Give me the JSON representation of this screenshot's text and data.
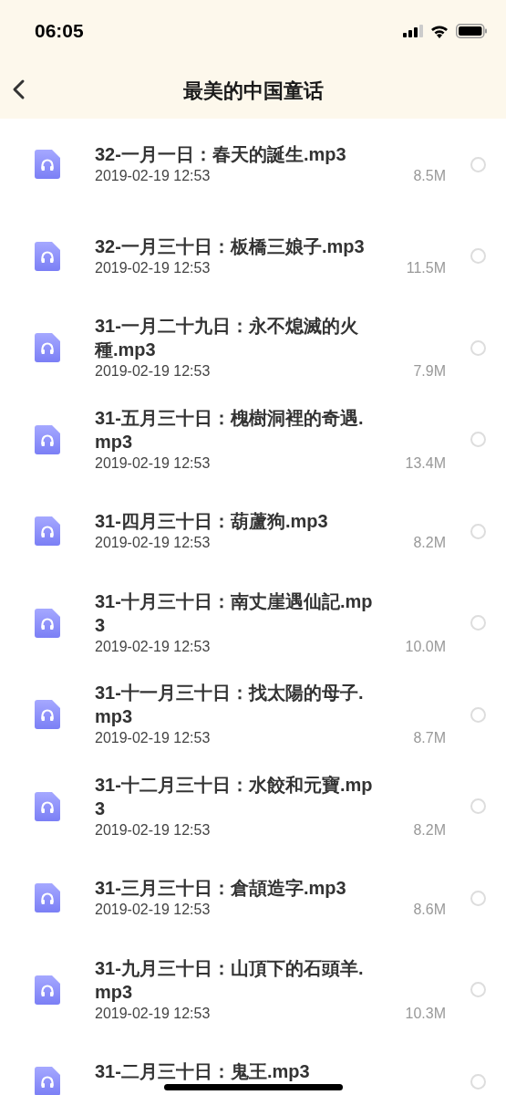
{
  "status_bar": {
    "time": "06:05"
  },
  "header": {
    "title": "最美的中国童话"
  },
  "files": [
    {
      "name": "32-一月一日：春天的誕生.mp3",
      "date": "2019-02-19 12:53",
      "size": "8.5M",
      "selected": false
    },
    {
      "name": "32-一月三十日：板橋三娘子.mp3",
      "date": "2019-02-19 12:53",
      "size": "11.5M",
      "selected": false
    },
    {
      "name": "31-一月二十九日：永不熄滅的火種.mp3",
      "date": "2019-02-19 12:53",
      "size": "7.9M",
      "selected": false
    },
    {
      "name": "31-五月三十日：槐樹洞裡的奇遇.mp3",
      "date": "2019-02-19 12:53",
      "size": "13.4M",
      "selected": false
    },
    {
      "name": "31-四月三十日：葫蘆狗.mp3",
      "date": "2019-02-19 12:53",
      "size": "8.2M",
      "selected": false
    },
    {
      "name": "31-十月三十日：南丈崖遇仙記.mp3",
      "date": "2019-02-19 12:53",
      "size": "10.0M",
      "selected": false
    },
    {
      "name": "31-十一月三十日：找太陽的母子.mp3",
      "date": "2019-02-19 12:53",
      "size": "8.7M",
      "selected": false
    },
    {
      "name": "31-十二月三十日：水餃和元寶.mp3",
      "date": "2019-02-19 12:53",
      "size": "8.2M",
      "selected": false
    },
    {
      "name": "31-三月三十日：倉頡造字.mp3",
      "date": "2019-02-19 12:53",
      "size": "8.6M",
      "selected": false
    },
    {
      "name": "31-九月三十日：山頂下的石頭羊.mp3",
      "date": "2019-02-19 12:53",
      "size": "10.3M",
      "selected": false
    },
    {
      "name": "31-二月三十日：鬼王.mp3",
      "selected": false
    }
  ]
}
